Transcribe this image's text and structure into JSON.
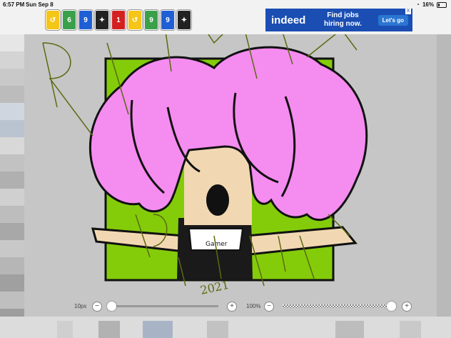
{
  "status": {
    "time": "6:57 PM",
    "date": "Sun Sep 8",
    "battery": "16%"
  },
  "ad": {
    "brand": "indeed",
    "line1": "Find jobs",
    "line2": "hiring now.",
    "cta": "Let's go",
    "close": "X"
  },
  "cards": [
    {
      "label": "↺",
      "color": "#f5c518"
    },
    {
      "label": "6",
      "color": "#3aa04a"
    },
    {
      "label": "9",
      "color": "#1e5fd6"
    },
    {
      "label": "✦",
      "color": "#222"
    },
    {
      "label": "1",
      "color": "#d32020"
    },
    {
      "label": "↺",
      "color": "#f5c518"
    },
    {
      "label": "9",
      "color": "#3aa04a"
    },
    {
      "label": "9",
      "color": "#1e5fd6"
    },
    {
      "label": "✦",
      "color": "#222"
    }
  ],
  "slider": {
    "brush_size_label": "10px",
    "brush_size_value": 0.0,
    "opacity_label": "100%",
    "opacity_value": 1.0,
    "minus": "−",
    "plus": "+"
  },
  "artwork": {
    "shirt_text": "Gamer",
    "year_text": "2021"
  },
  "colors": {
    "green": "#84cc0a",
    "hair": "#f58cf0",
    "skin": "#f2d8b2",
    "watermark": "#5a6a10"
  }
}
